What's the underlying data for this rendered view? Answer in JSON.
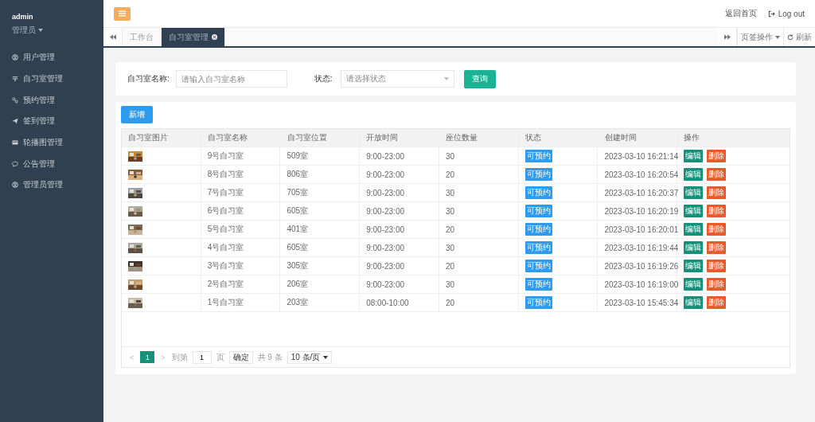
{
  "user": {
    "name": "admin",
    "role": "管理员"
  },
  "sidebar": {
    "items": [
      {
        "label": "用户管理",
        "selected": false
      },
      {
        "label": "自习室管理",
        "selected": false
      },
      {
        "label": "预约管理",
        "selected": false
      },
      {
        "label": "签到管理",
        "selected": false
      },
      {
        "label": "轮播图管理",
        "selected": false
      },
      {
        "label": "公告管理",
        "selected": false
      },
      {
        "label": "管理员管理",
        "selected": false
      }
    ]
  },
  "header": {
    "links": [
      "返回首页",
      "Log out"
    ]
  },
  "tabs": [
    {
      "label": "工作台",
      "selected": false,
      "closable": false
    },
    {
      "label": "自习室管理",
      "selected": true,
      "closable": true
    }
  ],
  "tab_tools": {
    "menu": "页签操作",
    "refresh": "刷新"
  },
  "search": {
    "name_label": "自习室名称:",
    "name_placeholder": "请输入自习室名称",
    "status_label": "状态:",
    "status_placeholder": "请选择状态",
    "button": "查询"
  },
  "add_button": "新增",
  "table": {
    "columns": [
      "自习室图片",
      "自习室名称",
      "自习室位置",
      "开放时间",
      "座位数量",
      "状态",
      "创建时间",
      "操作"
    ],
    "rows": [
      {
        "name": "9号自习室",
        "location": "509室",
        "hours": "9:00-23:00",
        "seats": "30",
        "status": "可预约",
        "created": "2023-03-10 16:21:14",
        "actions": [
          "编辑",
          "删除"
        ]
      },
      {
        "name": "8号自习室",
        "location": "806室",
        "hours": "9:00-23:00",
        "seats": "20",
        "status": "可预约",
        "created": "2023-03-10 16:20:54",
        "actions": [
          "编辑",
          "删除"
        ]
      },
      {
        "name": "7号自习室",
        "location": "705室",
        "hours": "9:00-23:00",
        "seats": "30",
        "status": "可预约",
        "created": "2023-03-10 16:20:37",
        "actions": [
          "编辑",
          "删除"
        ]
      },
      {
        "name": "6号自习室",
        "location": "605室",
        "hours": "9:00-23:00",
        "seats": "30",
        "status": "可预约",
        "created": "2023-03-10 16:20:19",
        "actions": [
          "编辑",
          "删除"
        ]
      },
      {
        "name": "5号自习室",
        "location": "401室",
        "hours": "9:00-23:00",
        "seats": "20",
        "status": "可预约",
        "created": "2023-03-10 16:20:01",
        "actions": [
          "编辑",
          "删除"
        ]
      },
      {
        "name": "4号自习室",
        "location": "605室",
        "hours": "9:00-23:00",
        "seats": "30",
        "status": "可预约",
        "created": "2023-03-10 16:19:44",
        "actions": [
          "编辑",
          "删除"
        ]
      },
      {
        "name": "3号自习室",
        "location": "305室",
        "hours": "9:00-23:00",
        "seats": "20",
        "status": "可预约",
        "created": "2023-03-10 16:19:26",
        "actions": [
          "编辑",
          "删除"
        ]
      },
      {
        "name": "2号自习室",
        "location": "206室",
        "hours": "9:00-23:00",
        "seats": "30",
        "status": "可预约",
        "created": "2023-03-10 16:19:00",
        "actions": [
          "编辑",
          "删除"
        ]
      },
      {
        "name": "1号自习室",
        "location": "203室",
        "hours": "08:00-10:00",
        "seats": "20",
        "status": "可预约",
        "created": "2023-03-10 15:45:34",
        "actions": [
          "编辑",
          "删除"
        ]
      }
    ]
  },
  "pagination": {
    "prev": "<",
    "pages": [
      {
        "label": "1",
        "selected": true
      }
    ],
    "next": ">",
    "goto_label": "到第",
    "goto_value": "1",
    "page_unit": "页",
    "confirm": "确定",
    "total": "共 9 条",
    "page_size": "10 条/页"
  }
}
